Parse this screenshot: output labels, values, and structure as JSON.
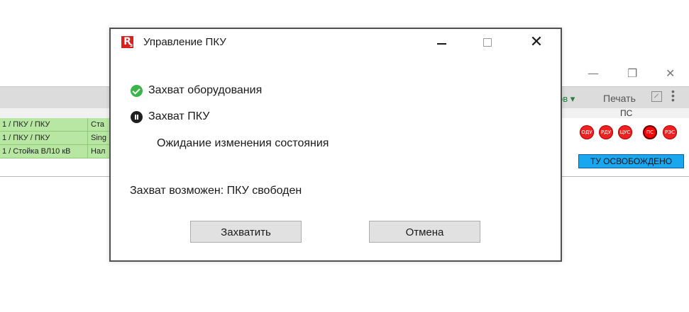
{
  "background": {
    "view_dropdown_label": "ов ▾",
    "print_label": "Печать",
    "column_header": "ПС",
    "rows": [
      {
        "path": "1 / ПКУ / ПКУ",
        "state": "Ста"
      },
      {
        "path": "1 / ПКУ / ПКУ",
        "state": "Sing"
      },
      {
        "path": "1 / Стойка ВЛ10 кВ",
        "state": "Нал"
      }
    ],
    "signals": [
      "ОДУ",
      "РДУ",
      "ЦУС",
      "ПС",
      "РЭС"
    ],
    "status_badge": "ТУ ОСВОБОЖДЕНО",
    "colors": {
      "row_green": "#b7e7a2",
      "badge_blue": "#19a8f0",
      "signal_red": "#ee2222"
    }
  },
  "dialog": {
    "title": "Управление ПКУ",
    "logo_text": "R",
    "logo_sub": "s",
    "steps": [
      {
        "label": "Захват оборудования",
        "status": "done",
        "icon": "check-circle-icon"
      },
      {
        "label": "Захват ПКУ",
        "status": "paused",
        "icon": "pause-circle-icon"
      }
    ],
    "substatus": "Ожидание изменения состояния",
    "availability": "Захват возможен: ПКУ свободен",
    "buttons": {
      "capture": "Захватить",
      "cancel": "Отмена"
    },
    "colors": {
      "logo_red": "#d8201f",
      "done_green": "#3bb54a"
    }
  }
}
